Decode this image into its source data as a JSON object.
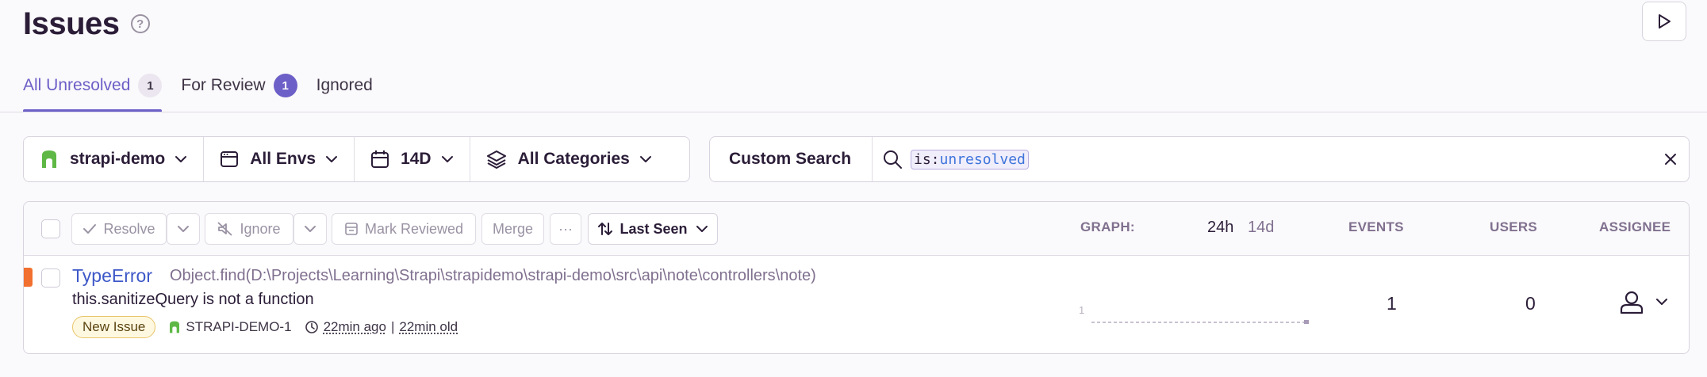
{
  "header": {
    "title": "Issues",
    "help_glyph": "?"
  },
  "tabs": [
    {
      "label": "All Unresolved",
      "count": "1",
      "active": true
    },
    {
      "label": "For Review",
      "count": "1",
      "active": false
    },
    {
      "label": "Ignored",
      "active": false
    }
  ],
  "filters": {
    "project": "strapi-demo",
    "environment": "All Envs",
    "date_range": "14D",
    "category": "All Categories"
  },
  "search": {
    "mode_label": "Custom Search",
    "token_key": "is:",
    "token_value": "unresolved"
  },
  "toolbar": {
    "resolve": "Resolve",
    "ignore": "Ignore",
    "mark_reviewed": "Mark Reviewed",
    "merge": "Merge",
    "more": "···",
    "sort": "Last Seen"
  },
  "columns": {
    "graph": "GRAPH:",
    "range_24h": "24h",
    "range_14d": "14d",
    "events": "EVENTS",
    "users": "USERS",
    "assignee": "ASSIGNEE"
  },
  "issues": [
    {
      "type": "TypeError",
      "location": "Object.find(D:\\Projects\\Learning\\Strapi\\strapidemo\\strapi-demo\\src\\api\\note\\controllers\\note)",
      "message": "this.sanitizeQuery is not a function",
      "status_badge": "New Issue",
      "project": "STRAPI-DEMO-1",
      "last_seen": "22min ago",
      "age": "22min old",
      "graph_max": "1",
      "events": "1",
      "users": "0"
    }
  ],
  "colors": {
    "accent": "#6c5fc7",
    "link": "#3d58c8",
    "level_error": "#f2702f",
    "project_icon": "#5fb846"
  },
  "icons": {
    "header": [
      "help-icon",
      "play-icon"
    ],
    "filters": [
      "project-icon",
      "env-window-icon",
      "calendar-icon",
      "stack-layers-icon",
      "chevron-down-icon"
    ],
    "search": [
      "search-icon",
      "close-icon"
    ],
    "toolbar": [
      "checkmark-icon",
      "mute-icon",
      "review-box-icon",
      "sort-arrows-icon"
    ],
    "row": [
      "project-icon",
      "clock-icon",
      "user-icon",
      "chevron-down-icon"
    ]
  }
}
